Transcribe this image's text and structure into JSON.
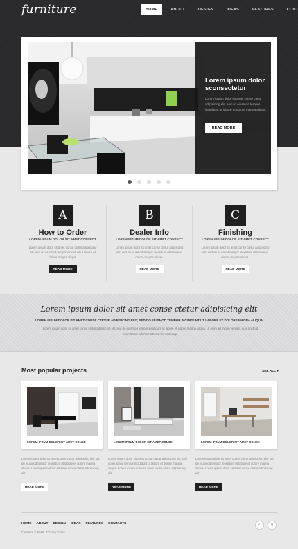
{
  "header": {
    "logo": "furniture",
    "nav": [
      "HOME",
      "ABOUT",
      "DESIGN",
      "IDEAS",
      "FEATURES",
      "CONTACTS"
    ],
    "active_nav": "HOME"
  },
  "slider": {
    "title": "Lorem ipsum dolor sconsectetur",
    "text": "Lorem ipsum dolor sit amet conse ctetur adipisicing elit, sed do eiusmod tempor incididunt ut labore et dolore magna aliqua.",
    "button": "READ MORE",
    "dots": 5,
    "active_dot": 1
  },
  "features": [
    {
      "letter": "A",
      "title": "How to Order",
      "subtitle": "LOREM IPSUM DOLOR SIT AMET CONSECT",
      "text": "Lorem ipsum dolor sit amet conse ctetur adipisicing elit, sed do eiusmod tempor incididunt ut labore et dolore magna aliqua.",
      "button": "READ MORE",
      "button_style": "dark"
    },
    {
      "letter": "B",
      "title": "Dealer Info",
      "subtitle": "LOREM IPSUM DOLOR SIT AMET CONSECT",
      "text": "Lorem ipsum dolor sit amet conse ctetur adipisicing elit, sed do eiusmod tempor incididunt ut labore et dolore magna aliqua.",
      "button": "READ MORE",
      "button_style": "light"
    },
    {
      "letter": "C",
      "title": "Finishing",
      "subtitle": "LOREM IPSUM DOLOR SIT AMET CONSECT",
      "text": "Lorem ipsum dolor sit amet conse ctetur adipisicing elit, sed do eiusmod tempor incididunt ut labore et dolore magna aliqua.",
      "button": "READ MORE",
      "button_style": "light"
    }
  ],
  "banner": {
    "title": "Lorem ipsum dolor sit amet conse ctetur adipisicing elit",
    "subtitle": "LOREM IPSUM DOLOR SIT AMET CONSE CTETUR ADIPISICING ELIT, SED DO EIUSMOD TEMPOR INCIDIDUNT UT LABORE ET DOLORE MAGNA ALIQUA",
    "text": "Lorem ipsum dolor sit amet conse ctetur adipisicing elit, sed do eiusmod tempor incididunt ut labore et dolore magna aliqua. Ut enim ad minim veniam, quis nostrud exercitation ullamco laboris nisi ut aliquip."
  },
  "projects": {
    "title": "Most popular projects",
    "see_all": "SEE ALL",
    "items": [
      {
        "caption": "LOREM IPSUM DOLOR SIT AMET CONSE",
        "text": "Lorem ipsum dolor sit amet conse ctetur adipisicing elit, sed do eiusmod tempor incididunt ut labore et dolore magna aliqua. Lorem ipsum dolor sit amet conse ctetur adipisicing elit.",
        "button": "READ MORE",
        "button_style": "light"
      },
      {
        "caption": "LOREM IPSUM DOLOR SIT AMET CONSE",
        "text": "Lorem ipsum dolor sit amet conse ctetur adipisicing elit, sed do eiusmod tempor incididunt ut labore et dolore magna aliqua. Lorem ipsum dolor sit amet conse ctetur adipisicing elit.",
        "button": "READ MORE",
        "button_style": "dark"
      },
      {
        "caption": "LOREM IPSUM DOLOR SIT AMET CONSE",
        "text": "Lorem ipsum dolor sit amet conse ctetur adipisicing elit, sed do eiusmod tempor incididunt ut labore et dolore magna aliqua. Lorem ipsum dolor sit amet conse ctetur adipisicing elit.",
        "button": "READ MORE",
        "button_style": "dark"
      }
    ]
  },
  "footer": {
    "nav": [
      "HOME",
      "ABOUT",
      "DESIGN",
      "IDEAS",
      "FEATURES",
      "CONTACTS"
    ],
    "copyright": "Furniture © 2012 · Privacy Policy",
    "social_icons": [
      "twitter-icon",
      "google-plus-icon"
    ]
  }
}
